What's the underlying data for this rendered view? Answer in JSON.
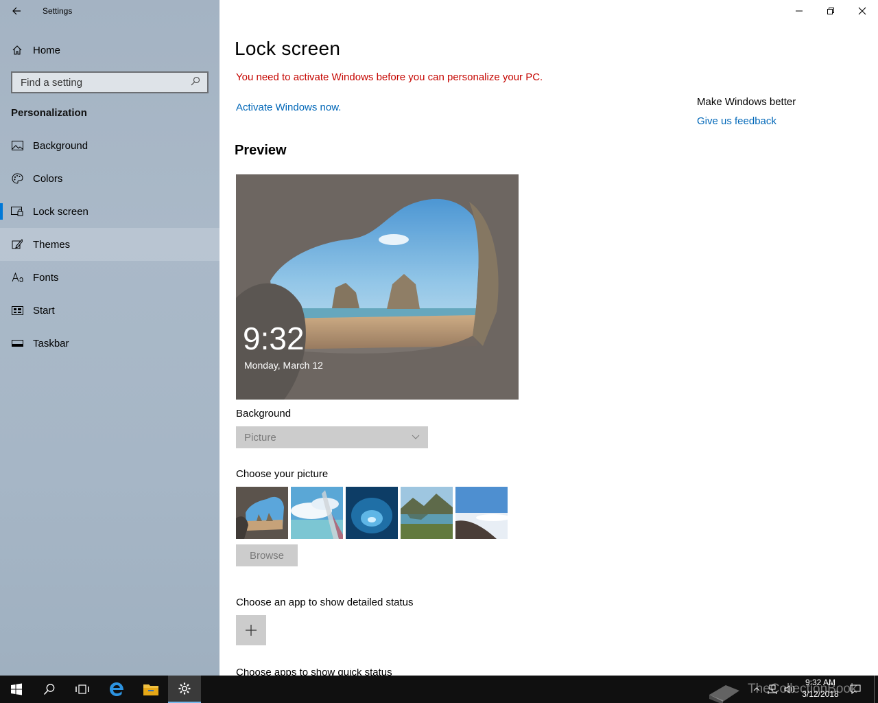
{
  "window": {
    "app_title": "Settings",
    "controls": [
      "minimize",
      "restore",
      "close"
    ]
  },
  "sidebar": {
    "home_label": "Home",
    "search_placeholder": "Find a setting",
    "section_title": "Personalization",
    "items": [
      {
        "label": "Background",
        "icon": "picture-icon"
      },
      {
        "label": "Colors",
        "icon": "palette-icon"
      },
      {
        "label": "Lock screen",
        "icon": "lock-screen-icon",
        "selected": true
      },
      {
        "label": "Themes",
        "icon": "brush-icon",
        "hover": true
      },
      {
        "label": "Fonts",
        "icon": "font-icon"
      },
      {
        "label": "Start",
        "icon": "start-icon"
      },
      {
        "label": "Taskbar",
        "icon": "taskbar-icon"
      }
    ]
  },
  "main": {
    "title": "Lock screen",
    "warning": "You need to activate Windows before you can personalize your PC.",
    "activate_link": "Activate Windows now.",
    "preview_heading": "Preview",
    "preview": {
      "time": "9:32",
      "date": "Monday, March 12"
    },
    "background_label": "Background",
    "background_value": "Picture",
    "choose_picture_label": "Choose your picture",
    "browse_label": "Browse",
    "detailed_status_label": "Choose an app to show detailed status",
    "quick_status_label": "Choose apps to show quick status"
  },
  "side_panel": {
    "title": "Make Windows better",
    "feedback_link": "Give us feedback"
  },
  "taskbar": {
    "time": "9:32 AM",
    "date": "3/12/2018",
    "watermark": "TheCollectionBook",
    "apps": [
      "start-icon",
      "search-icon",
      "task-view-icon",
      "edge-icon",
      "file-explorer-icon",
      "settings-icon"
    ]
  },
  "colors": {
    "accent": "#0078d7",
    "link": "#0067b8",
    "warning": "#c50500",
    "taskbar": "#101010"
  }
}
